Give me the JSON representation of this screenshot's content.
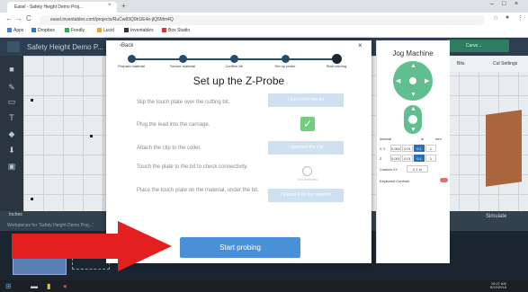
{
  "browser": {
    "tab_title": "Easel - Safety Height Demo Proj...",
    "tab_close": "×",
    "new_tab": "+",
    "url": "easel.inventables.com/projects/RuCw83Q9h1lE4e-jlQ5Mm4Q",
    "bookmarks": [
      "Apps",
      "Dropbox",
      "Feedly",
      "Lucid",
      "Inventables",
      "Box Studio"
    ],
    "nav_back": "←",
    "nav_forward": "→",
    "nav_reload": "C"
  },
  "app": {
    "title": "Safety Height Demo P...",
    "header_button": "Carve...",
    "right_labels": [
      "Bits",
      "Cut Settings"
    ],
    "bottom_labels": [
      "Workpieces for 'Safety Height Demo Proj...'"
    ],
    "zoom_label": "Inches",
    "simulate": "Simulate"
  },
  "modal": {
    "back_label": "Back",
    "close_label": "×",
    "title": "Set up the Z-Probe",
    "steps": [
      "Prepare material",
      "Secure material",
      "Confirm bit",
      "Set up probe",
      "Start carving"
    ],
    "active_step": 4,
    "rows": [
      {
        "text": "Slip the touch plate over the cutting bit.",
        "button": "I put it over the bit"
      },
      {
        "text": "Plug the lead into the carriage.",
        "button": ""
      },
      {
        "text": "Attach the clip to the collet.",
        "button": "I attached the clip"
      },
      {
        "text": "Touch the plate to the bit to check connectivity.",
        "button": "Not detected"
      },
      {
        "text": "Place the touch plate on the material, under the bit.",
        "button": "I placed it on the material"
      }
    ],
    "check_icon": "✓",
    "start_button": "Start probing"
  },
  "jog": {
    "title": "Jog Machine",
    "interval_label": "Interval",
    "unit_mm": "mm",
    "unit_in": "in",
    "xy_label": "X Y",
    "z_label": "Z",
    "xy_values": [
      "0.001",
      "0.01",
      "0.1",
      "1"
    ],
    "z_values": [
      "0.001",
      "0.01",
      "0.1",
      "1"
    ],
    "selected_index": 2,
    "custom_label": "Custom XY",
    "custom_value": "0.1 in",
    "keyboard_label": "Keyboard Controls"
  },
  "taskbar": {
    "time": "10:27 AM",
    "date": "6/19/2018"
  },
  "colors": {
    "accent": "#4a90d9",
    "jog_green": "#5fbf8f",
    "step_blue": "#234b6e",
    "arrow_red": "#e41f1f"
  }
}
